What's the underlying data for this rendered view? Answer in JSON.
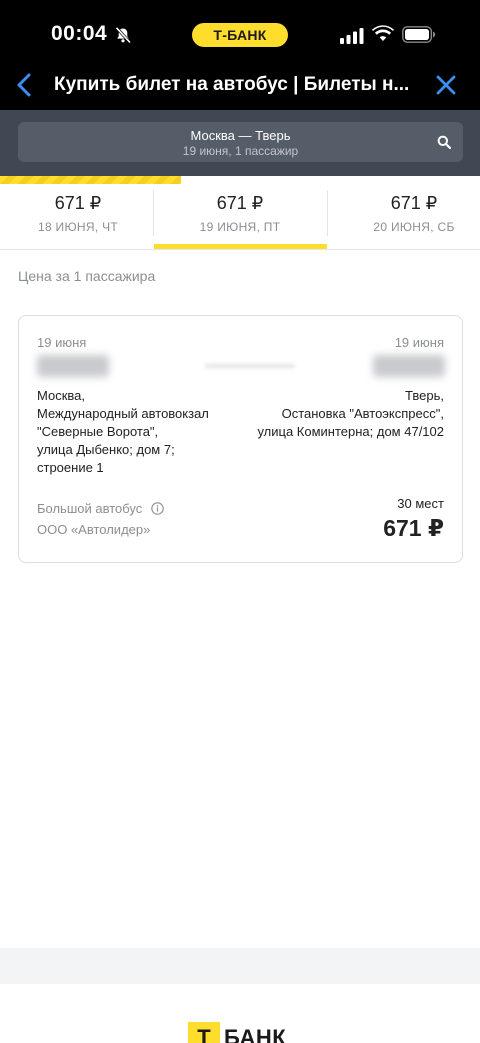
{
  "status_bar": {
    "time": "00:04",
    "brand_pill": "Т-БАНК",
    "icons": [
      "bell-muted-icon",
      "signal-icon",
      "wifi-icon",
      "battery-icon"
    ]
  },
  "nav": {
    "title": "Купить билет на автобус | Билеты н...",
    "back_icon": "chevron-left-icon",
    "close_icon": "close-icon"
  },
  "search": {
    "route": "Москва — Тверь",
    "details": "19 июня, 1 пассажир",
    "icon": "search-icon"
  },
  "date_tabs": [
    {
      "price": "671 ₽",
      "day": "18 ИЮНЯ, ЧТ",
      "selected": false
    },
    {
      "price": "671 ₽",
      "day": "19 ИЮНЯ, ПТ",
      "selected": true
    },
    {
      "price": "671 ₽",
      "day": "20 ИЮНЯ, СБ",
      "selected": false
    }
  ],
  "price_note": "Цена за 1 пассажира",
  "trip": {
    "departure_date": "19 июня",
    "arrival_date": "19 июня",
    "departure_address": [
      "Москва,",
      "Международный автовокзал",
      "\"Северные Ворота\",",
      "улица Дыбенко; дом 7;",
      "строение 1"
    ],
    "arrival_address": [
      "Тверь,",
      "Остановка \"Автоэкспресс\",",
      "улица Коминтерна; дом 47/102"
    ],
    "bus_type": "Большой автобус",
    "operator": "ООО «Автолидер»",
    "seats": "30 мест",
    "price": "671 ₽"
  },
  "footer": {
    "logo_mark": "Т",
    "logo_text": "БАНК"
  },
  "colors": {
    "accent": "#ffdd2d",
    "header_bg": "#000000",
    "search_bg": "#404854",
    "link_blue": "#3b8ff0"
  }
}
